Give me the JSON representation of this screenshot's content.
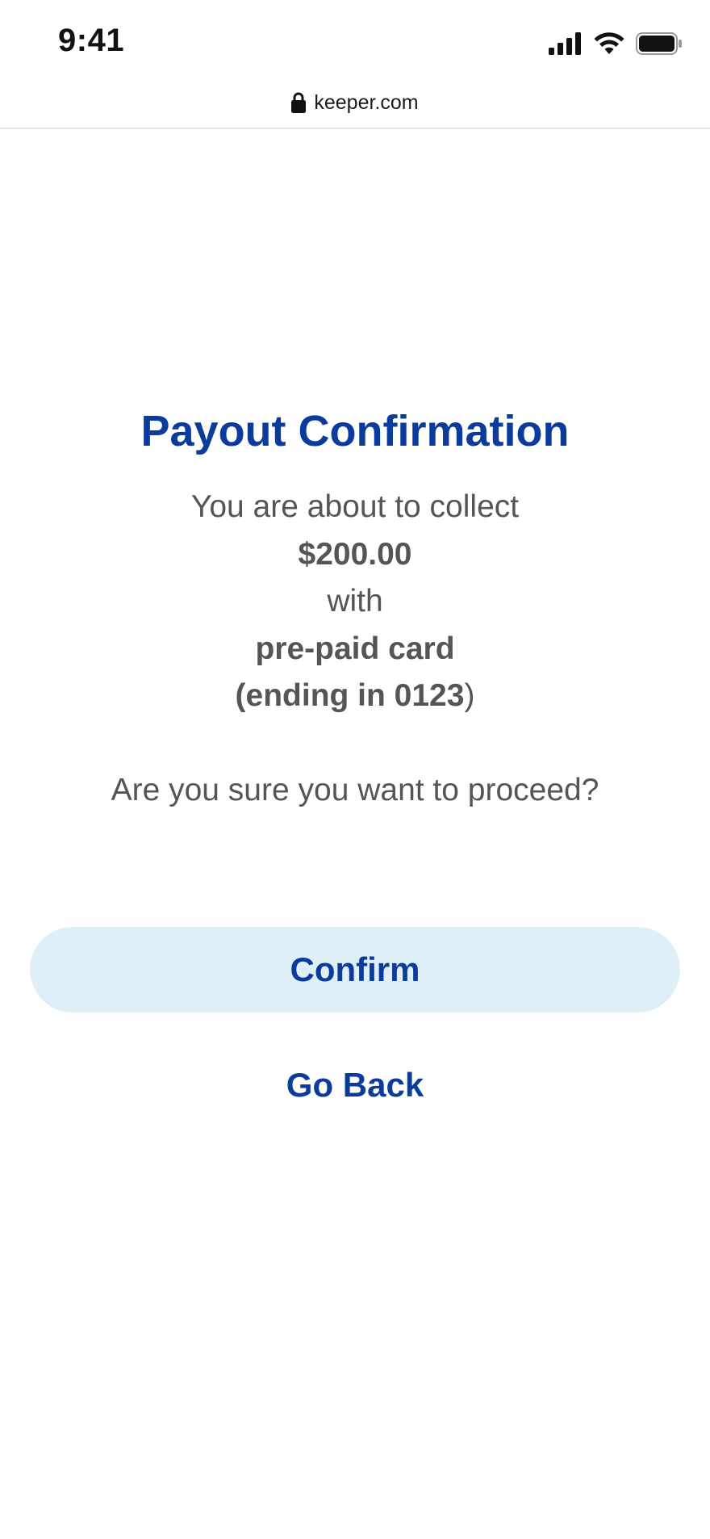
{
  "status_bar": {
    "time": "9:41",
    "icons": [
      "signal-icon",
      "wifi-icon",
      "battery-icon"
    ]
  },
  "browser": {
    "url": "keeper.com",
    "lock_icon": "lock-icon"
  },
  "payout": {
    "title": "Payout Confirmation",
    "line1": "You are about to collect",
    "amount": "$200.00",
    "line3": "with",
    "method": "pre-paid card",
    "card_ending_open": "(ending in 0123",
    "card_ending_close": ")",
    "question": "Are you sure you want to proceed?"
  },
  "actions": {
    "confirm_label": "Confirm",
    "go_back_label": "Go Back"
  },
  "colors": {
    "accent": "#0b3c9c",
    "button_bg": "#dfeff8",
    "body_text": "#555555",
    "background": "#ffffff"
  }
}
